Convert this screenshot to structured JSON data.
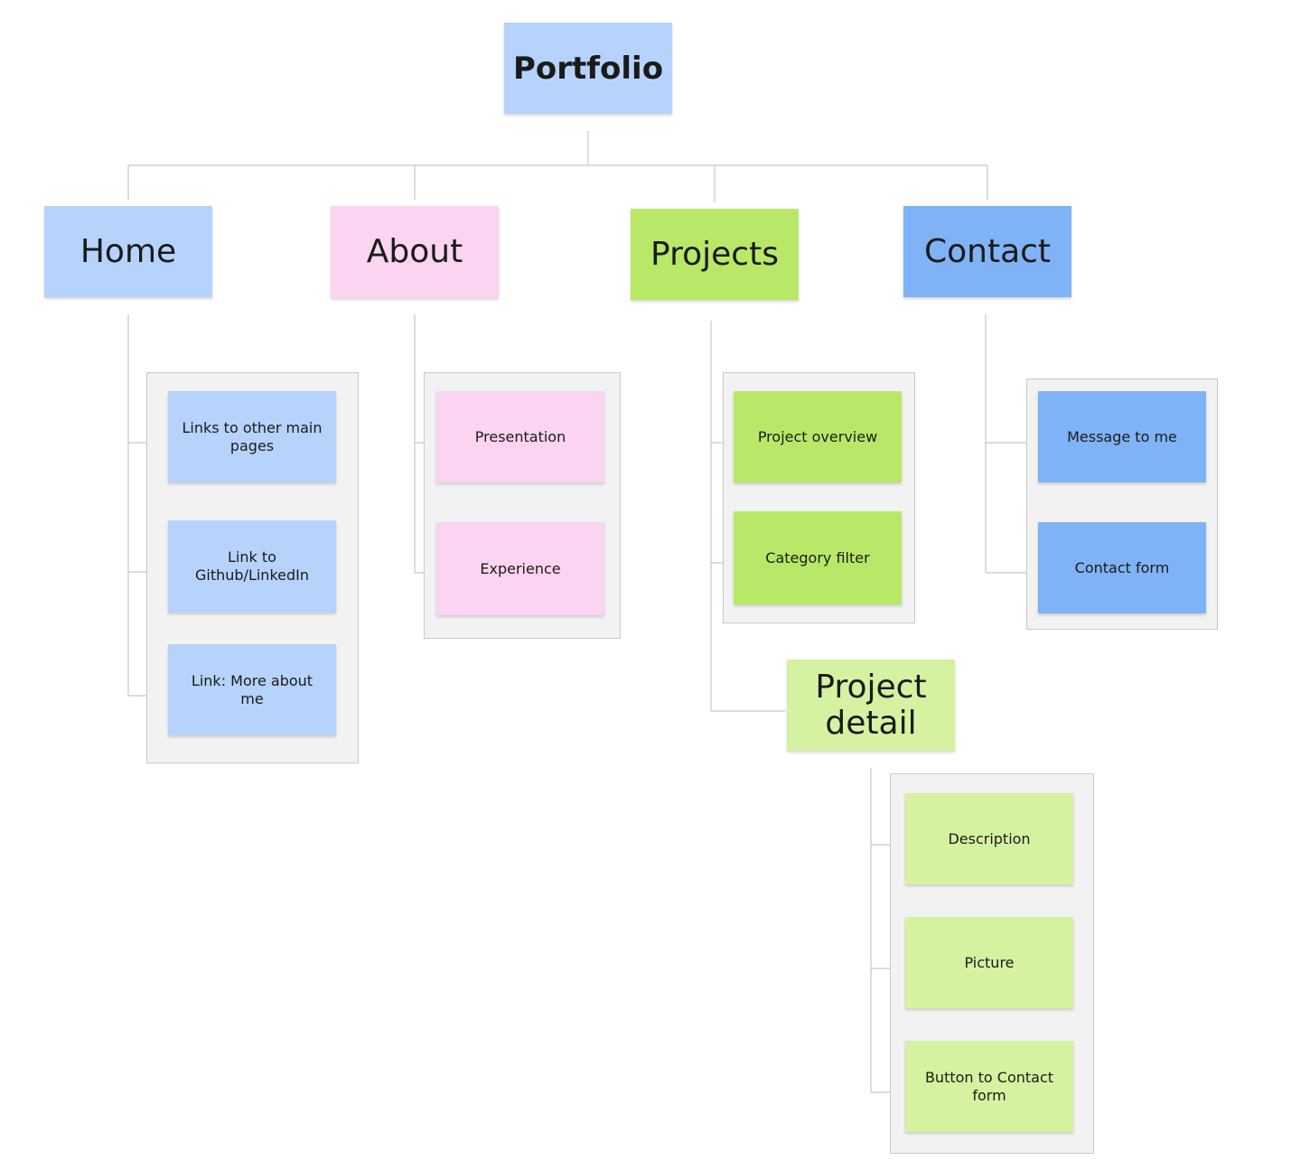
{
  "diagram": {
    "root": {
      "label": "Portfolio"
    },
    "sections": [
      {
        "key": "home",
        "label": "Home",
        "color": "#b6d3fb",
        "items": [
          "Links to other main pages",
          "Link to Github/LinkedIn",
          "Link: More about me"
        ]
      },
      {
        "key": "about",
        "label": "About",
        "color": "#fbd4f1",
        "items": [
          "Presentation",
          "Experience"
        ]
      },
      {
        "key": "projects",
        "label": "Projects",
        "color": "#b9e868",
        "items": [
          "Project overview",
          "Category filter"
        ],
        "child": {
          "label": "Project detail",
          "color": "#d5f2a1",
          "items": [
            "Description",
            "Picture",
            "Button to Contact form"
          ]
        }
      },
      {
        "key": "contact",
        "label": "Contact",
        "color": "#80b2f6",
        "items": [
          "Message to me",
          "Contact form"
        ]
      }
    ]
  }
}
